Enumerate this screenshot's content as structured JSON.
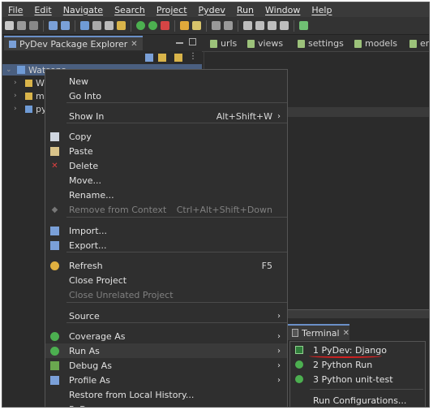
{
  "menubar": [
    "File",
    "Edit",
    "Navigate",
    "Search",
    "Project",
    "Pydev",
    "Run",
    "Window",
    "Help"
  ],
  "package_explorer": {
    "tab_title": "PyDev Package Explorer",
    "tree": [
      {
        "label": "Watsons..."
      },
      {
        "label": "W"
      },
      {
        "label": "m"
      },
      {
        "label": "py"
      }
    ]
  },
  "editor_tabs": [
    "urls",
    "views",
    "settings",
    "models",
    "emb"
  ],
  "context_menu": {
    "items": [
      {
        "label": "New",
        "shortcut": "",
        "arrow": false,
        "disabled": false,
        "icon": ""
      },
      {
        "label": "Go Into",
        "shortcut": "",
        "arrow": false,
        "disabled": false,
        "icon": ""
      },
      {
        "label": "Show In",
        "shortcut": "Alt+Shift+W",
        "arrow": true,
        "disabled": false,
        "icon": ""
      },
      {
        "label": "Copy",
        "shortcut": "",
        "arrow": false,
        "disabled": false,
        "icon": "copy-icon"
      },
      {
        "label": "Paste",
        "shortcut": "",
        "arrow": false,
        "disabled": false,
        "icon": "paste-icon"
      },
      {
        "label": "Delete",
        "shortcut": "",
        "arrow": false,
        "disabled": false,
        "icon": "delete-icon"
      },
      {
        "label": "Move...",
        "shortcut": "",
        "arrow": false,
        "disabled": false,
        "icon": ""
      },
      {
        "label": "Rename...",
        "shortcut": "",
        "arrow": false,
        "disabled": false,
        "icon": ""
      },
      {
        "label": "Remove from Context",
        "shortcut": "Ctrl+Alt+Shift+Down",
        "arrow": false,
        "disabled": true,
        "icon": "remove-context-icon"
      },
      {
        "label": "Import...",
        "shortcut": "",
        "arrow": false,
        "disabled": false,
        "icon": "import-icon"
      },
      {
        "label": "Export...",
        "shortcut": "",
        "arrow": false,
        "disabled": false,
        "icon": "export-icon"
      },
      {
        "label": "Refresh",
        "shortcut": "F5",
        "arrow": false,
        "disabled": false,
        "icon": "refresh-icon"
      },
      {
        "label": "Close Project",
        "shortcut": "",
        "arrow": false,
        "disabled": false,
        "icon": ""
      },
      {
        "label": "Close Unrelated Project",
        "shortcut": "",
        "arrow": false,
        "disabled": true,
        "icon": ""
      },
      {
        "label": "Source",
        "shortcut": "",
        "arrow": true,
        "disabled": false,
        "icon": ""
      },
      {
        "label": "Coverage As",
        "shortcut": "",
        "arrow": true,
        "disabled": false,
        "icon": "coverage-icon"
      },
      {
        "label": "Run As",
        "shortcut": "",
        "arrow": true,
        "disabled": false,
        "icon": "run-icon"
      },
      {
        "label": "Debug As",
        "shortcut": "",
        "arrow": true,
        "disabled": false,
        "icon": "debug-icon"
      },
      {
        "label": "Profile As",
        "shortcut": "",
        "arrow": true,
        "disabled": false,
        "icon": "profile-icon"
      },
      {
        "label": "Restore from Local History...",
        "shortcut": "",
        "arrow": false,
        "disabled": false,
        "icon": ""
      },
      {
        "label": "PyDev",
        "shortcut": "",
        "arrow": true,
        "disabled": false,
        "icon": ""
      }
    ]
  },
  "terminal_tab": {
    "label": "Terminal"
  },
  "run_as_submenu": {
    "items": [
      {
        "label": "1 PyDev: Django",
        "icon": "django-icon"
      },
      {
        "label": "2 Python Run",
        "icon": "python-run-icon"
      },
      {
        "label": "3 Python unit-test",
        "icon": "python-unittest-icon"
      },
      {
        "label": "Run Configurations...",
        "icon": ""
      }
    ]
  },
  "colors": {
    "accent": "#6a8fc7",
    "highlight_underline": "#d62020",
    "background": "#2b2b2b"
  }
}
